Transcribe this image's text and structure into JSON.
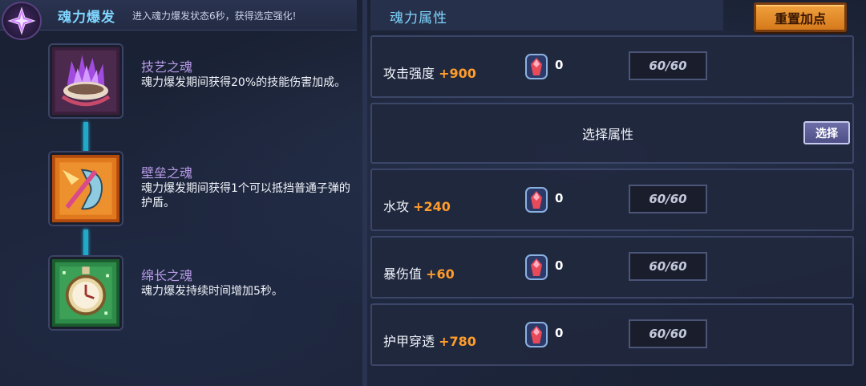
{
  "header": {
    "title": "魂力爆发",
    "description": "进入魂力爆发状态6秒，获得选定强化!"
  },
  "souls": [
    {
      "name": "技艺之魂",
      "desc": "魂力爆发期间获得20%的技能伤害加成。",
      "icon": "purple-flame-bowl-icon"
    },
    {
      "name": "壁垒之魂",
      "desc": "魂力爆发期间获得1个可以抵挡普通子弹的护盾。",
      "icon": "shield-axe-icon"
    },
    {
      "name": "绵长之魂",
      "desc": "魂力爆发持续时间增加5秒。",
      "icon": "pocket-watch-icon"
    }
  ],
  "panel": {
    "title": "魂力属性",
    "reset_label": "重置加点",
    "select_label": "选择属性",
    "select_button": "选择"
  },
  "attributes": [
    {
      "name": "攻击强度",
      "bonus": "+900",
      "gems": "0",
      "level": "60/60"
    },
    {
      "name": "水攻",
      "bonus": "+240",
      "gems": "0",
      "level": "60/60"
    },
    {
      "name": "暴伤值",
      "bonus": "+60",
      "gems": "0",
      "level": "60/60"
    },
    {
      "name": "护甲穿透",
      "bonus": "+780",
      "gems": "0",
      "level": "60/60"
    }
  ],
  "colors": {
    "accent_title": "#7fd6ff",
    "bonus": "#ff9c2a",
    "soul_name": "#b79ae6",
    "connector": "#24a8c8"
  }
}
